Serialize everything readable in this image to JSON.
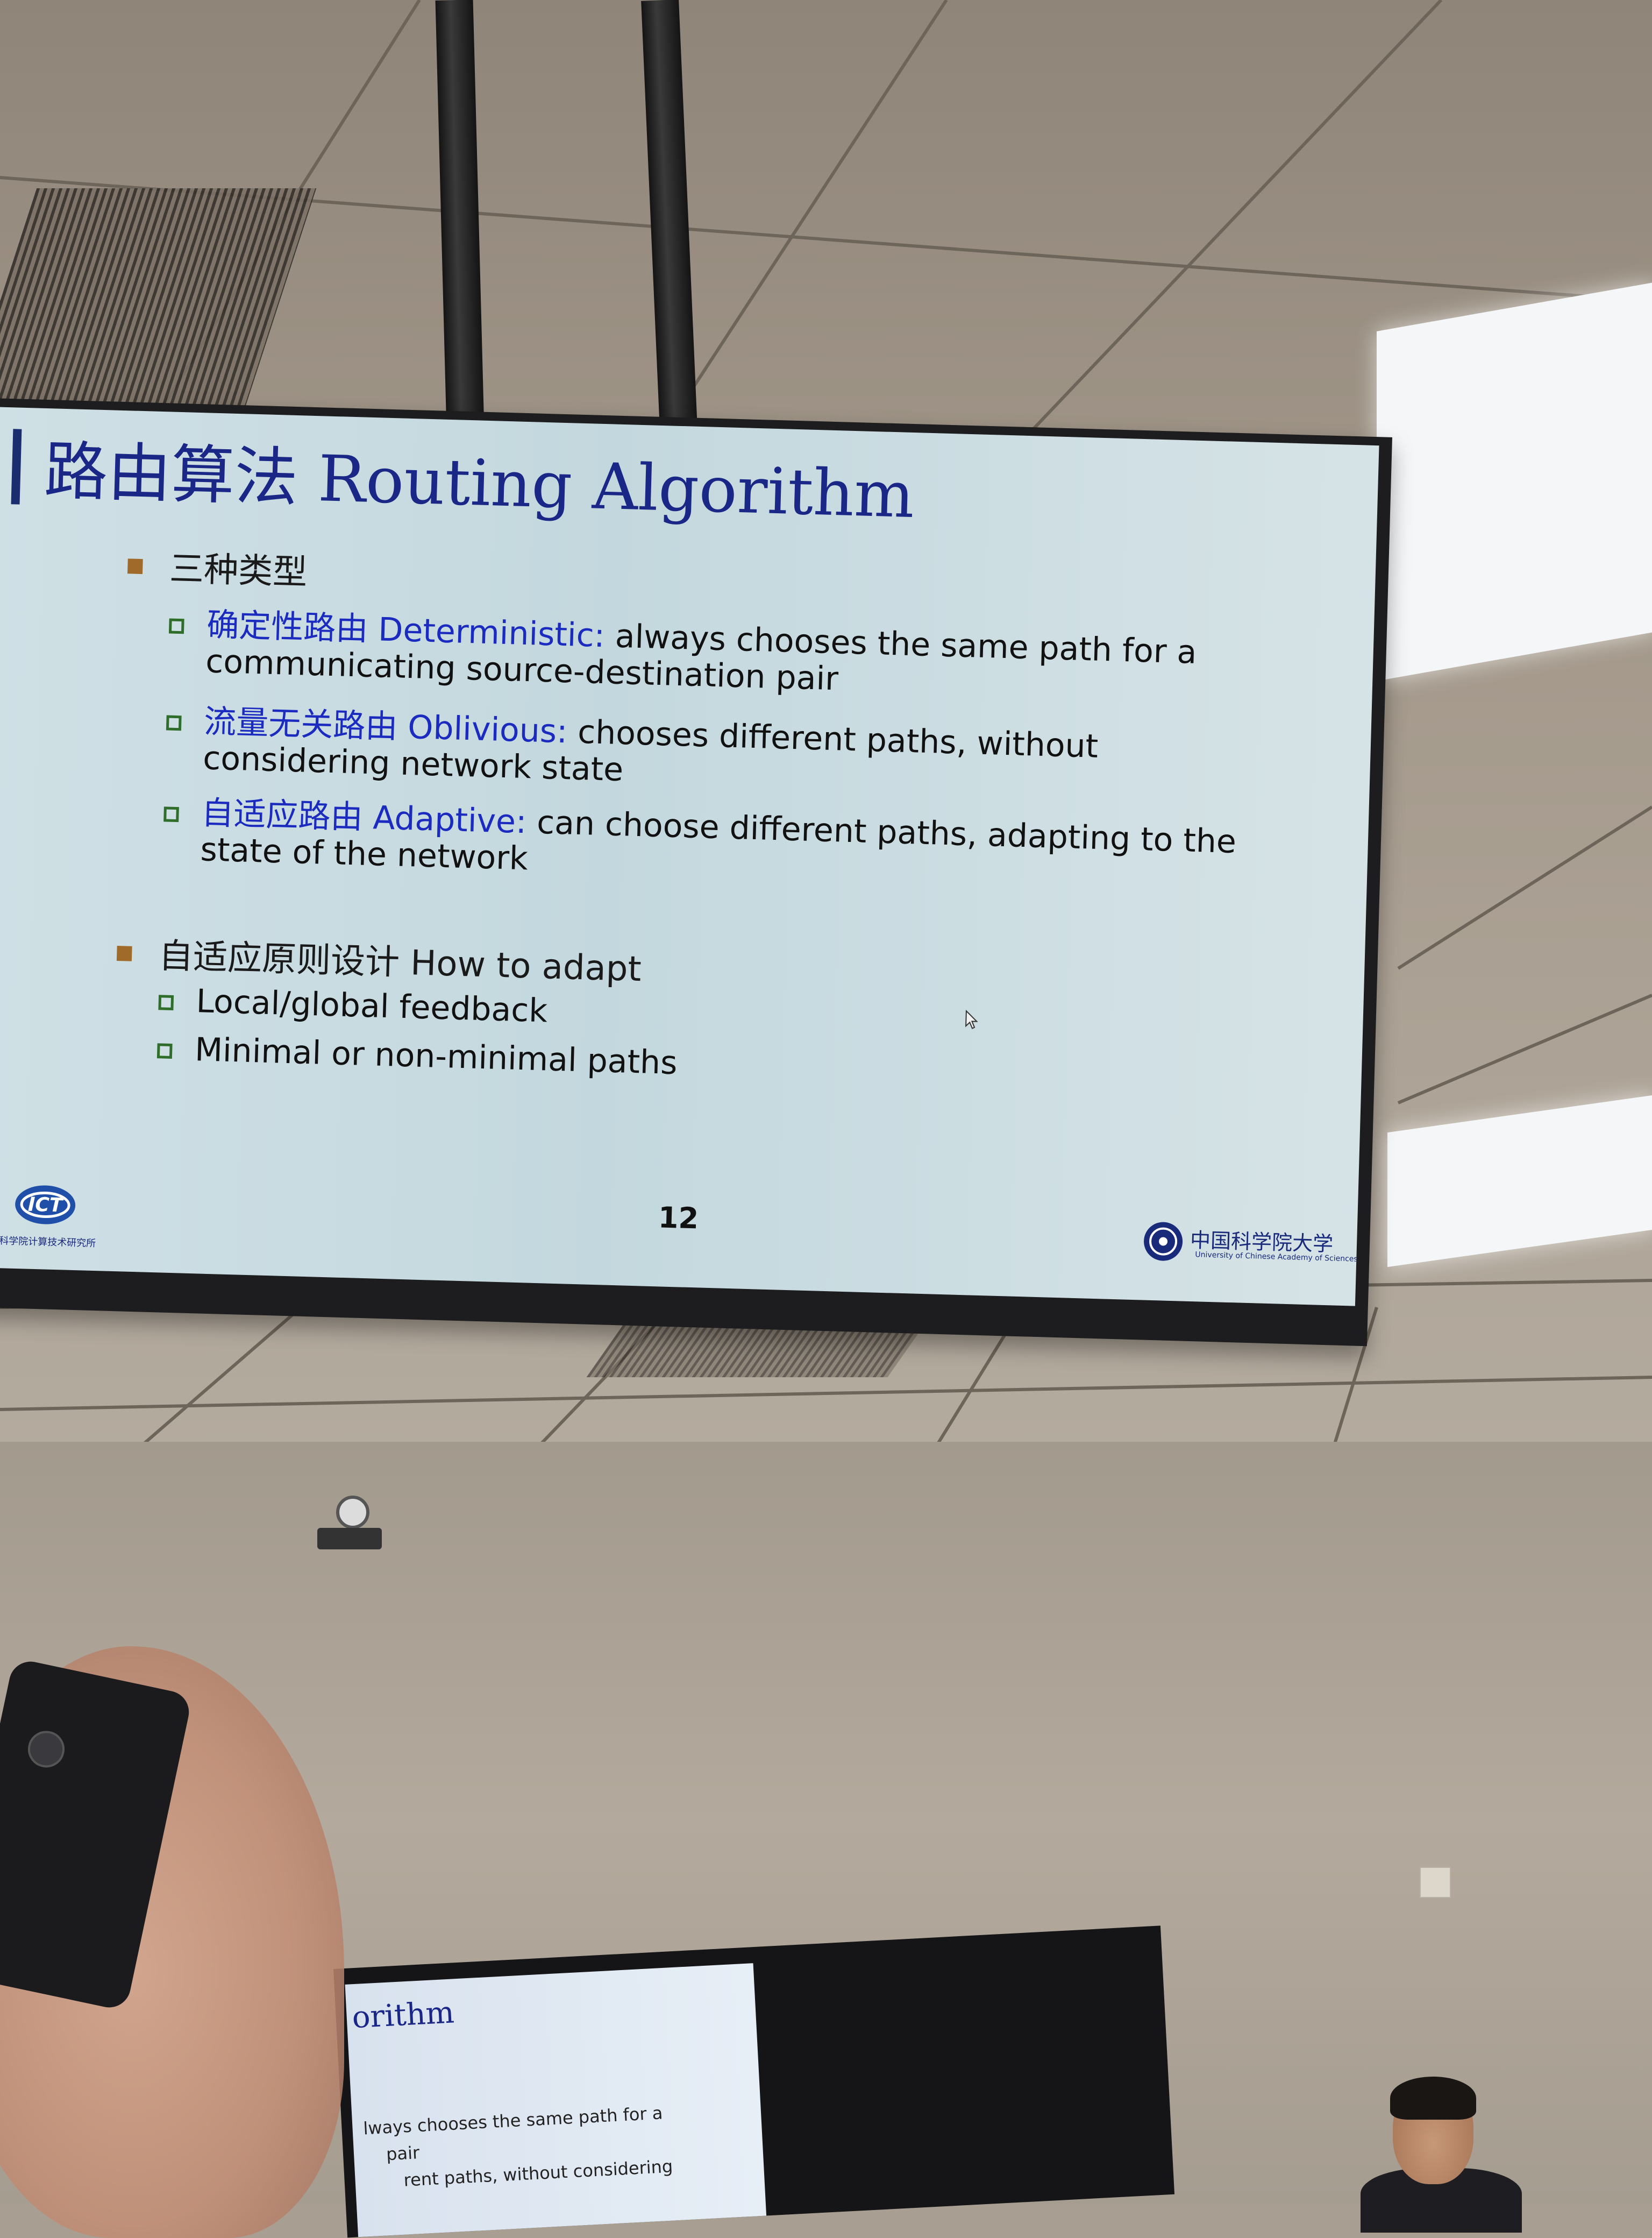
{
  "main_slide": {
    "title": "路由算法 Routing Algorithm",
    "sections": [
      {
        "heading": "三种类型",
        "items": [
          {
            "term": "确定性路由 Deterministic:",
            "text": "always chooses the same path for a communicating source-destination pair"
          },
          {
            "term": "流量无关路由 Oblivious:",
            "text": "chooses different paths, without considering network state"
          },
          {
            "term": "自适应路由 Adaptive:",
            "text": "can choose different paths, adapting to the state of the network"
          }
        ]
      },
      {
        "heading": "自适应原则设计 How to adapt",
        "items": [
          {
            "term": "",
            "text": "Local/global feedback"
          },
          {
            "term": "",
            "text": "Minimal or non-minimal paths"
          }
        ]
      }
    ],
    "page_number": "12",
    "logo_left_text": "中国科学院计算技术研究所",
    "logo_right_text": "中国科学院大学",
    "logo_right_sub": "University of Chinese Academy of Sciences",
    "colors": {
      "title": "#1a2787",
      "term": "#1b2bc0",
      "l1_marker": "#a06a2b",
      "l2_marker": "#2e6d2a"
    }
  },
  "secondary_slide": {
    "title_fragment": "orithm",
    "line_1": "lways chooses the same path for a",
    "line_2": "pair",
    "line_3": "rent paths, without considering"
  }
}
